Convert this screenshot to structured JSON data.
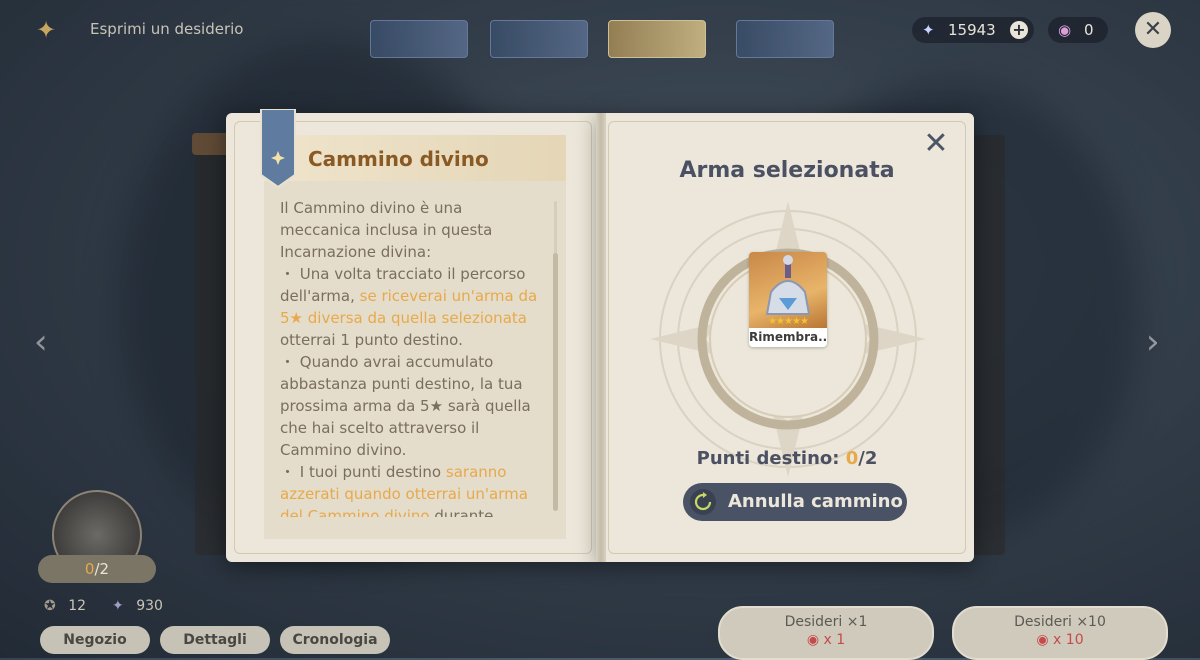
{
  "topbar": {
    "title": "Esprimi un desiderio",
    "primogems": "15943",
    "fates": "0"
  },
  "bottom": {
    "fate_points_current": "0",
    "fate_points_sep_total": "/2",
    "starglitter": "12",
    "stardust": "930",
    "shop_label": "Negozio",
    "details_label": "Dettagli",
    "history_label": "Cronologia",
    "wish1_label": "Desideri ×1",
    "wish1_cost": "x 1",
    "wish10_label": "Desideri ×10",
    "wish10_cost": "x 10"
  },
  "book": {
    "left_title": "Cammino divino",
    "paragraphs": {
      "p1": "Il Cammino divino è una meccanica inclusa in questa Incarnazione divina:",
      "p2_a": "・ Una volta tracciato il percorso dell'arma, ",
      "p2_hl": "se riceverai un'arma da 5★ diversa da quella selezionata",
      "p2_b": " otterrai 1 punto destino.",
      "p3": "・ Quando avrai accumulato abbastanza punti destino, la tua prossima arma da 5★ sarà quella che hai scelto attraverso il Cammino divino.",
      "p4_a": "・ I tuoi punti destino ",
      "p4_hl": "saranno azzerati quando otterrai un'arma del Cammino divino",
      "p4_b": " durante"
    },
    "right_title": "Arma selezionata",
    "weapon_name": "Rimembra..",
    "weapon_stars": "★★★★★",
    "fate_points_label": "Punti destino: ",
    "fate_points_current": "0",
    "fate_points_total": "/2",
    "cancel_label": "Annulla cammino"
  },
  "colors": {
    "accent_orange": "#e8a94a",
    "title_brown": "#8a5a24",
    "button_dark": "#4a5366"
  }
}
